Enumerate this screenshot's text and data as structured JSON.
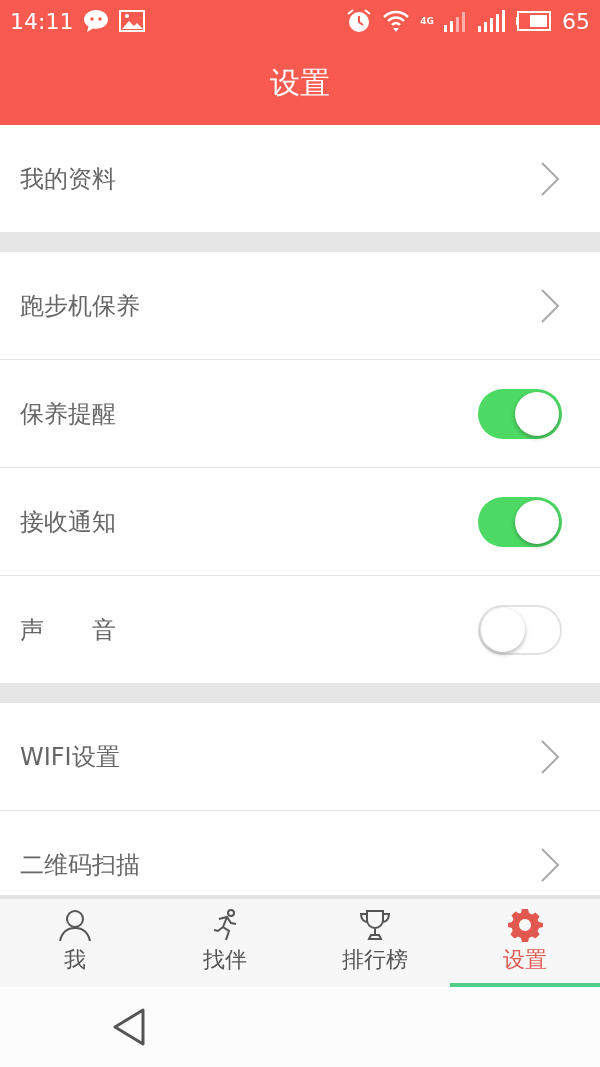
{
  "status_bar": {
    "time": "14:11",
    "network": "4G",
    "battery": "65"
  },
  "header": {
    "title": "设置"
  },
  "sections": [
    {
      "items": [
        {
          "kind": "link",
          "label": "我的资料"
        }
      ]
    },
    {
      "items": [
        {
          "kind": "link",
          "label": "跑步机保养"
        },
        {
          "kind": "toggle",
          "label": "保养提醒",
          "on": true
        },
        {
          "kind": "toggle",
          "label": "接收通知",
          "on": true
        },
        {
          "kind": "toggle",
          "label": "声　　音",
          "on": false
        }
      ]
    },
    {
      "items": [
        {
          "kind": "link",
          "label": "WIFI设置"
        },
        {
          "kind": "link",
          "label": "二维码扫描"
        }
      ]
    }
  ],
  "tabs": [
    {
      "label": "我",
      "kind": "person",
      "selected": false
    },
    {
      "label": "找伴",
      "kind": "runner",
      "selected": false
    },
    {
      "label": "排行榜",
      "kind": "trophy",
      "selected": false
    },
    {
      "label": "设置",
      "kind": "gear",
      "selected": true
    }
  ]
}
